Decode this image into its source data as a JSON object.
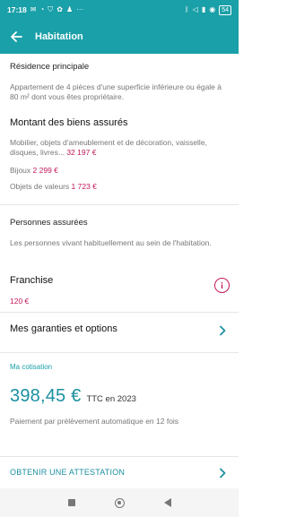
{
  "status_bar": {
    "time": "17:18",
    "battery": "54"
  },
  "app_bar": {
    "title": "Habitation"
  },
  "residence": {
    "title": "Résidence principale",
    "description": "Appartement de 4 pièces d'une superficie inférieure ou égale à 80 m² dont vous êtes propriétaire."
  },
  "biens": {
    "title": "Montant des biens assurés",
    "mobilier_label": "Mobilier, objets d'ameublement et de décoration, vaisselle, disques, livres...",
    "mobilier_value": "32 197 €",
    "bijoux_label": "Bijoux",
    "bijoux_value": "2 299 €",
    "valeurs_label": "Objets de valeurs",
    "valeurs_value": "1 723 €"
  },
  "personnes": {
    "title": "Personnes assurées",
    "description": "Les personnes vivant habituellement au sein de l'habitation."
  },
  "franchise": {
    "title": "Franchise",
    "value": "120 €"
  },
  "garanties": {
    "label": "Mes garanties et options"
  },
  "cotisation": {
    "label": "Ma cotisation",
    "amount": "398,45 €",
    "suffix": "TTC en 2023",
    "payment": "Paiement par prélèvement automatique en 12 fois"
  },
  "attestation": {
    "label": "OBTENIR UNE ATTESTATION"
  },
  "colors": {
    "teal": "#1aa0a8",
    "pink": "#c2185b"
  }
}
